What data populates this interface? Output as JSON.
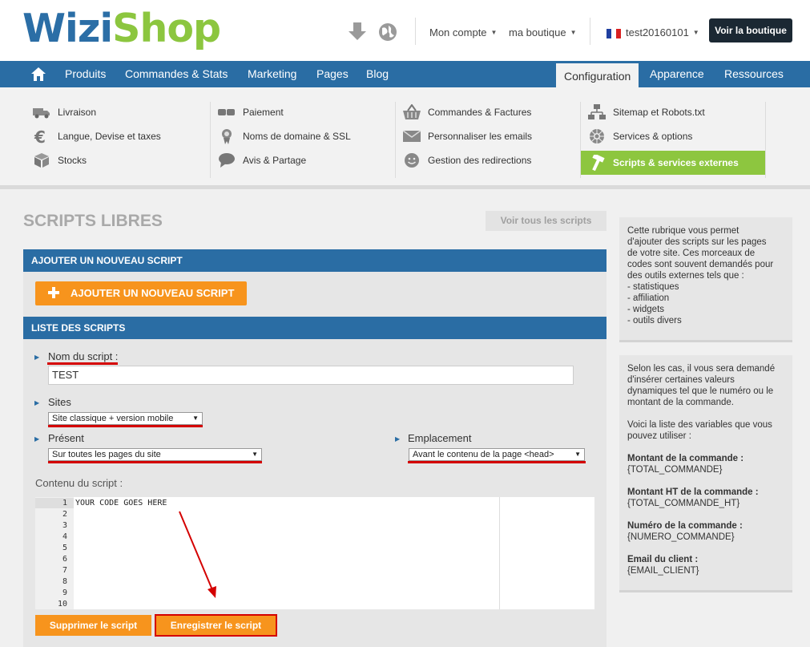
{
  "header": {
    "logo_part1": "Wizi",
    "logo_part2": "Shop",
    "account_menu": "Mon compte",
    "store_menu": "ma boutique",
    "user_menu": "test20160101",
    "view_store_button": "Voir la boutique",
    "brand_blue": "#2b6ea6",
    "brand_green": "#8cc63f"
  },
  "nav": {
    "items": [
      "Produits",
      "Commandes & Stats",
      "Marketing",
      "Pages",
      "Blog",
      "Configuration",
      "Apparence",
      "Ressources"
    ],
    "active": "Configuration"
  },
  "submenu": {
    "col1": [
      "Livraison",
      "Langue, Devise et taxes",
      "Stocks"
    ],
    "col2": [
      "Paiement",
      "Noms de domaine & SSL",
      "Avis & Partage"
    ],
    "col3": [
      "Commandes & Factures",
      "Personnaliser les emails",
      "Gestion des redirections"
    ],
    "col4": [
      "Sitemap et Robots.txt",
      "Services & options",
      "Scripts & services externes"
    ],
    "active": "Scripts & services externes"
  },
  "main": {
    "title": "SCRIPTS LIBRES",
    "view_all_button": "Voir tous les scripts",
    "add_section_header": "AJOUTER UN NOUVEAU SCRIPT",
    "add_button": "AJOUTER UN NOUVEAU SCRIPT",
    "list_section_header": "LISTE DES SCRIPTS",
    "name_label": "Nom du script :",
    "name_value": "TEST",
    "sites_label": "Sites",
    "sites_value": "Site classique + version mobile",
    "present_label": "Présent",
    "present_value": "Sur toutes les pages du site",
    "location_label": "Emplacement",
    "location_value": "Avant le contenu de la page <head>",
    "content_label": "Contenu du script :",
    "code_line_1": "YOUR CODE GOES HERE",
    "line_numbers": [
      "1",
      "2",
      "3",
      "4",
      "5",
      "6",
      "7",
      "8",
      "9",
      "10"
    ],
    "delete_button": "Supprimer le script",
    "save_button": "Enregistrer le script"
  },
  "aside": {
    "box1": [
      "Cette rubrique vous permet",
      "d'ajouter des scripts sur les pages",
      "de votre site. Ces morceaux de",
      "codes sont souvent demandés pour",
      "des outils externes tels que :",
      "- statistiques",
      "- affiliation",
      "- widgets",
      "- outils divers"
    ],
    "box2_intro": [
      "Selon les cas, il vous sera demandé",
      "d'insérer certaines valeurs",
      "dynamiques tel que le numéro ou le",
      "montant de la commande."
    ],
    "box2_list_intro": [
      "Voici la liste des variables que vous",
      "pouvez utiliser :"
    ],
    "variables": [
      {
        "label": "Montant de la commande :",
        "value": "{TOTAL_COMMANDE}"
      },
      {
        "label": "Montant HT de la commande :",
        "value": "{TOTAL_COMMANDE_HT}"
      },
      {
        "label": "Numéro de la commande :",
        "value": "{NUMERO_COMMANDE}"
      },
      {
        "label": "Email du client :",
        "value": "{EMAIL_CLIENT}"
      }
    ]
  }
}
